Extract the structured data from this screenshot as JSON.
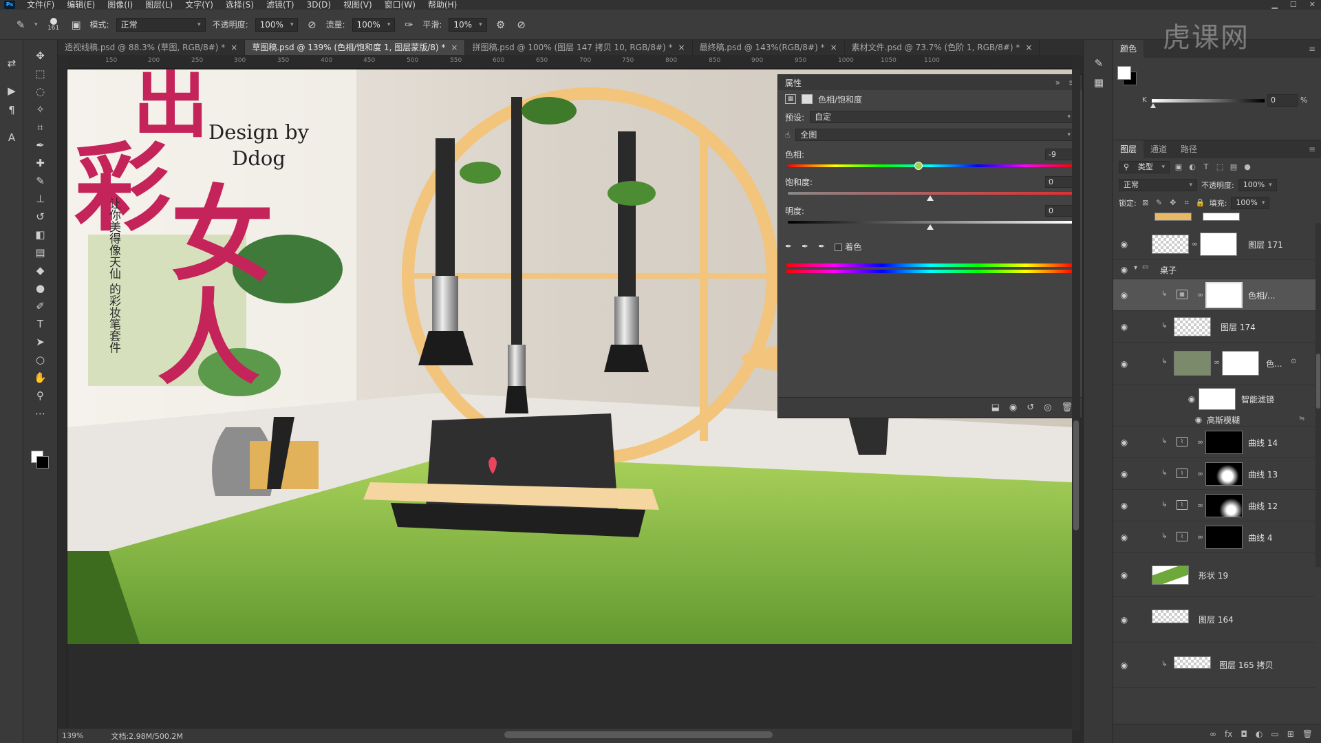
{
  "menubar": {
    "logo": "Ps",
    "items": [
      "文件(F)",
      "编辑(E)",
      "图像(I)",
      "图层(L)",
      "文字(Y)",
      "选择(S)",
      "滤镜(T)",
      "3D(D)",
      "视图(V)",
      "窗口(W)",
      "帮助(H)"
    ]
  },
  "options": {
    "brush_size": "161",
    "mode_label": "模式:",
    "mode_value": "正常",
    "opacity_label": "不透明度:",
    "opacity_value": "100%",
    "flow_label": "流量:",
    "flow_value": "100%",
    "smooth_label": "平滑:",
    "smooth_value": "10%"
  },
  "tabs": [
    {
      "label": "透视线稿.psd @ 88.3% (草图, RGB/8#) *"
    },
    {
      "label": "草图稿.psd @ 139% (色相/饱和度 1, 图层蒙版/8) *"
    },
    {
      "label": "拼图稿.psd @ 100% (图层 147 拷贝 10, RGB/8#) *"
    },
    {
      "label": "最终稿.psd @ 143%(RGB/8#) *"
    },
    {
      "label": "素材文件.psd @ 73.7% (色阶 1, RGB/8#) *"
    }
  ],
  "ruler": {
    "ticks": [
      "150",
      "200",
      "250",
      "300",
      "350",
      "400",
      "450",
      "500",
      "550",
      "600",
      "650",
      "700",
      "750",
      "800",
      "850",
      "900",
      "950",
      "1000",
      "1050",
      "1100"
    ]
  },
  "canvas": {
    "design_line1": "Design by",
    "design_line2": "Ddog",
    "calli_1": "出",
    "calli_2": "彩",
    "calli_3": "女",
    "calli_4": "人",
    "vertical_text": "让你美得像天仙 的彩妆笔套件"
  },
  "status": {
    "zoom": "139%",
    "doc": "文档:2.98M/500.2M"
  },
  "properties": {
    "title": "属性",
    "type_label": "色相/饱和度",
    "preset_label": "预设:",
    "preset_value": "自定",
    "channel_value": "全图",
    "hue_label": "色相:",
    "hue_value": "-9",
    "hue_fraction": 0.46,
    "sat_label": "饱和度:",
    "sat_value": "0",
    "sat_fraction": 0.5,
    "light_label": "明度:",
    "light_value": "0",
    "light_fraction": 0.5,
    "colorize_label": "着色"
  },
  "color_panel": {
    "tab": "颜色",
    "k_label": "K",
    "k_value": "0",
    "k_unit": "%"
  },
  "layers_panel": {
    "tabs": [
      "图层",
      "通道",
      "路径"
    ],
    "filter_label": "类型",
    "blend_mode": "正常",
    "opacity_label": "不透明度:",
    "opacity_value": "100%",
    "lock_label": "锁定:",
    "fill_label": "填充:",
    "fill_value": "100%",
    "layers": [
      {
        "name": "图层 171"
      },
      {
        "name": "桌子"
      },
      {
        "name": "色相/..."
      },
      {
        "name": "图层 174"
      },
      {
        "name": "色..."
      },
      {
        "name": "智能滤镜"
      },
      {
        "name": "高斯模糊"
      },
      {
        "name": "曲线 14"
      },
      {
        "name": "曲线 13"
      },
      {
        "name": "曲线 12"
      },
      {
        "name": "曲线 4"
      },
      {
        "name": "形状 19"
      },
      {
        "name": "图层 164"
      },
      {
        "name": "图层 165 拷贝"
      }
    ]
  },
  "watermark": "虎课网",
  "colors": {
    "accent_pink": "#c4245a",
    "table_green": "#6fa83a",
    "ring_gold": "#f2c47c"
  }
}
